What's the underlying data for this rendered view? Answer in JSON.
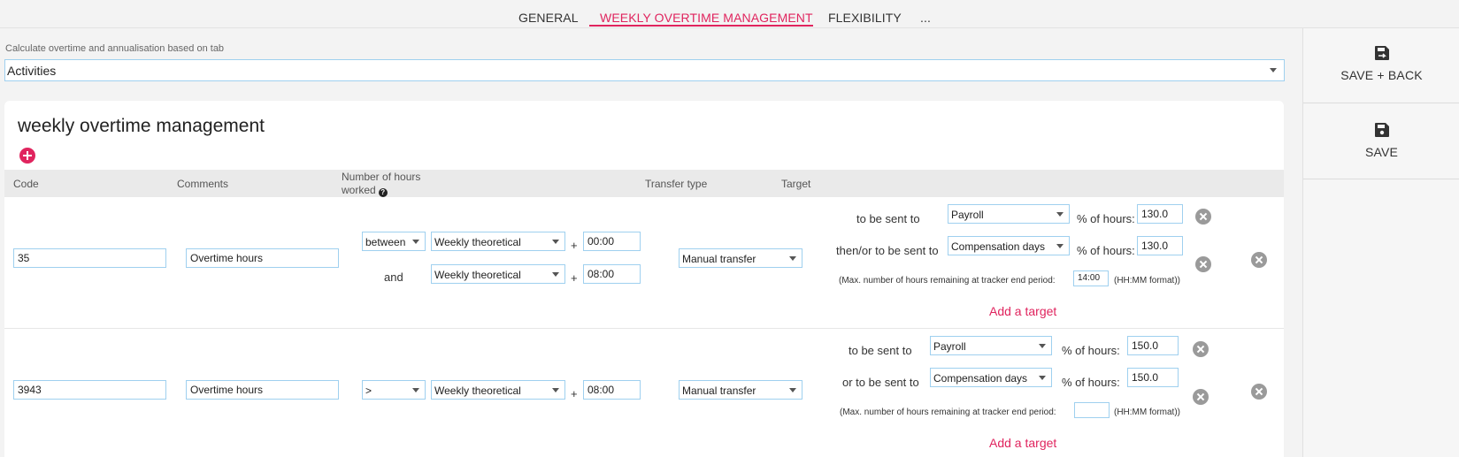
{
  "tabs": [
    {
      "label": "GENERAL",
      "active": false
    },
    {
      "label": "WEEKLY OVERTIME MANAGEMENT",
      "active": true
    },
    {
      "label": "FLEXIBILITY",
      "active": false
    },
    {
      "label": "...",
      "active": false
    }
  ],
  "sidebar": {
    "save_back": "SAVE + BACK",
    "save": "SAVE"
  },
  "calc": {
    "label": "Calculate overtime and annualisation based on tab",
    "value": "Activities"
  },
  "section": {
    "title": "weekly overtime management"
  },
  "columns": {
    "code": "Code",
    "comments": "Comments",
    "hours_line1": "Number of hours",
    "hours_line2": "worked",
    "transfer": "Transfer type",
    "target": "Target"
  },
  "rows": [
    {
      "code": "35",
      "comment": "Overtime hours",
      "operator": "between",
      "ref1": "Weekly theoretical",
      "time1": "00:00",
      "and_label": "and",
      "ref2": "Weekly theoretical",
      "time2": "08:00",
      "transfer": "Manual transfer",
      "target1_label": "to be sent to",
      "target1_value": "Payroll",
      "target1_pct_label": "% of hours:",
      "target1_pct": "130.0",
      "target2_label": "then/or to be sent to",
      "target2_value": "Compensation days",
      "target2_pct_label": "% of hours:",
      "target2_pct": "130.0",
      "max_label": "(Max. number of hours remaining at tracker end period:",
      "max_value": "14:00",
      "max_format": "(HH:MM format))",
      "add_target": "Add a target"
    },
    {
      "code": "3943",
      "comment": "Overtime hours",
      "operator": ">",
      "ref1": "Weekly theoretical",
      "time1": "08:00",
      "transfer": "Manual transfer",
      "target1_label": "to be sent to",
      "target1_value": "Payroll",
      "target1_pct_label": "% of hours:",
      "target1_pct": "150.0",
      "target2_label": "or to be sent to",
      "target2_value": "Compensation days",
      "target2_pct_label": "% of hours:",
      "target2_pct": "150.0",
      "max_label": "(Max. number of hours remaining at tracker end period:",
      "max_value": "",
      "max_format": "(HH:MM format))",
      "add_target": "Add a target"
    }
  ],
  "colors": {
    "accent": "#e0245e",
    "input_border": "#9fd0ef"
  }
}
